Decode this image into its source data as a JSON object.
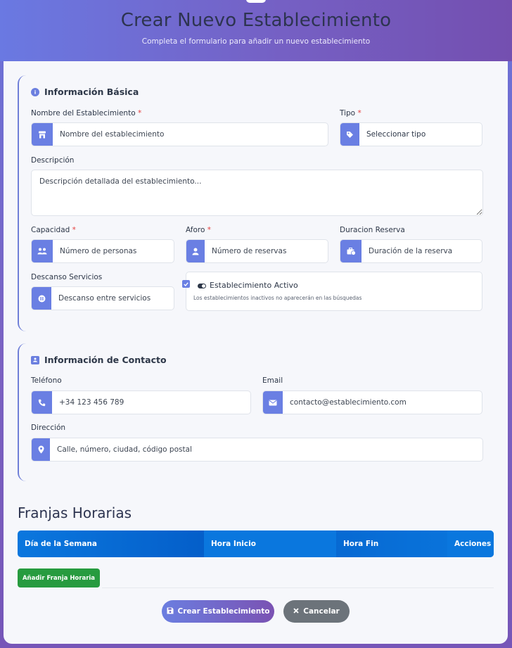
{
  "header": {
    "title": "Crear Nuevo Establecimiento",
    "subtitle": "Completa el formulario para añadir un nuevo establecimiento"
  },
  "basic": {
    "title": "Información Básica",
    "name_label": "Nombre del Establecimiento",
    "name_placeholder": "Nombre del establecimiento",
    "type_label": "Tipo",
    "type_value": "Seleccionar tipo",
    "desc_label": "Descripción",
    "desc_placeholder": "Descripción detallada del establecimiento...",
    "capacity_label": "Capacidad",
    "capacity_placeholder": "Número de personas",
    "aforo_label": "Aforo",
    "aforo_placeholder": "Número de reservas",
    "duration_label": "Duracion Reserva",
    "duration_placeholder": "Duración de la reserva",
    "rest_label": "Descanso Servicios",
    "rest_placeholder": "Descanso entre servicios",
    "active_label": "Establecimiento Activo",
    "active_hint": "Los establecimientos inactivos no aparecerán en las búsquedas",
    "required_mark": "*"
  },
  "contact": {
    "title": "Información de Contacto",
    "phone_label": "Teléfono",
    "phone_placeholder": "+34 123 456 789",
    "email_label": "Email",
    "email_placeholder": "contacto@establecimiento.com",
    "address_label": "Dirección",
    "address_placeholder": "Calle, número, ciudad, código postal"
  },
  "slots": {
    "title": "Franjas Horarias",
    "columns": [
      "Día de la Semana",
      "Hora Inicio",
      "Hora Fin",
      "Acciones"
    ],
    "add_label": "Añadir Franja Horaria"
  },
  "footer": {
    "create_label": "Crear Establecimiento",
    "cancel_label": "Cancelar"
  },
  "colors": {
    "accent": "#6a7fe3",
    "table_header": "#0a77de",
    "add_button": "#279b3f",
    "cancel_button": "#6c737a"
  },
  "icons": [
    "info-icon",
    "store-icon",
    "tag-icon",
    "users-icon",
    "user-icon",
    "briefcase-clock-icon",
    "pause-icon",
    "toggle-icon",
    "contact-card-icon",
    "phone-icon",
    "mail-icon",
    "location-icon",
    "save-icon",
    "close-icon"
  ]
}
